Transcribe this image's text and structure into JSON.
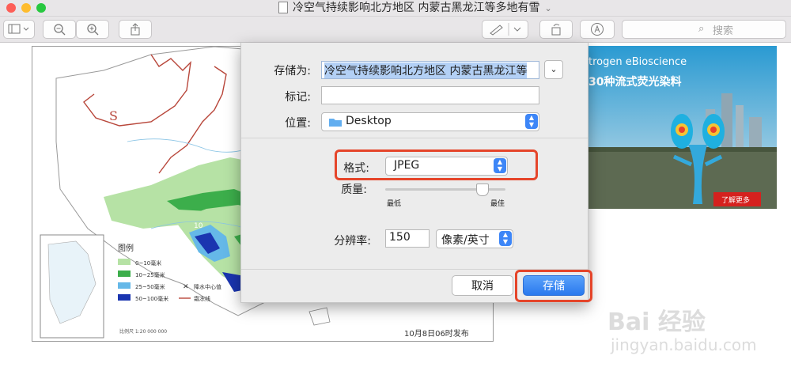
{
  "window": {
    "title": "冷空气持续影响北方地区 内蒙古黑龙江等多地有雪",
    "traffic_colors": [
      "#fd5e57",
      "#febc2e",
      "#28c840"
    ]
  },
  "toolbar": {
    "search_placeholder": "搜索"
  },
  "map": {
    "legend_title": "图例",
    "legend": [
      {
        "label": "0~10毫米",
        "color": "#b6e2a5"
      },
      {
        "label": "10~25毫米",
        "color": "#3cae4b"
      },
      {
        "label": "25~50毫米",
        "color": "#65b8e8"
      },
      {
        "label": "50~100毫米",
        "color": "#1a35b0"
      }
    ],
    "legend_marks": [
      "降水中心值",
      "霜冻线"
    ],
    "symbol_s": "S",
    "scale": "比例尺 1:20 000 000",
    "footer": "10月8日06时发布",
    "value_label": "10"
  },
  "ad": {
    "brand": "trogen eBioscience",
    "slogan": "30种流式荧光染料",
    "cta": "了解更多"
  },
  "save_dialog": {
    "save_as_label": "存储为:",
    "filename": "冷空气持续影响北方地区 内蒙古黑龙江等",
    "tags_label": "标记:",
    "tags_value": "",
    "where_label": "位置:",
    "where_value": "Desktop",
    "format_label": "格式:",
    "format_value": "JPEG",
    "quality_label": "质量:",
    "quality_min": "最低",
    "quality_max": "最佳",
    "quality_level": 0.8,
    "resolution_label": "分辨率:",
    "resolution_value": "150",
    "resolution_unit": "像素/英寸",
    "cancel_label": "取消",
    "save_label": "存储"
  },
  "watermark": {
    "brand": "Bai 经验",
    "url": "jingyan.baidu.com"
  }
}
